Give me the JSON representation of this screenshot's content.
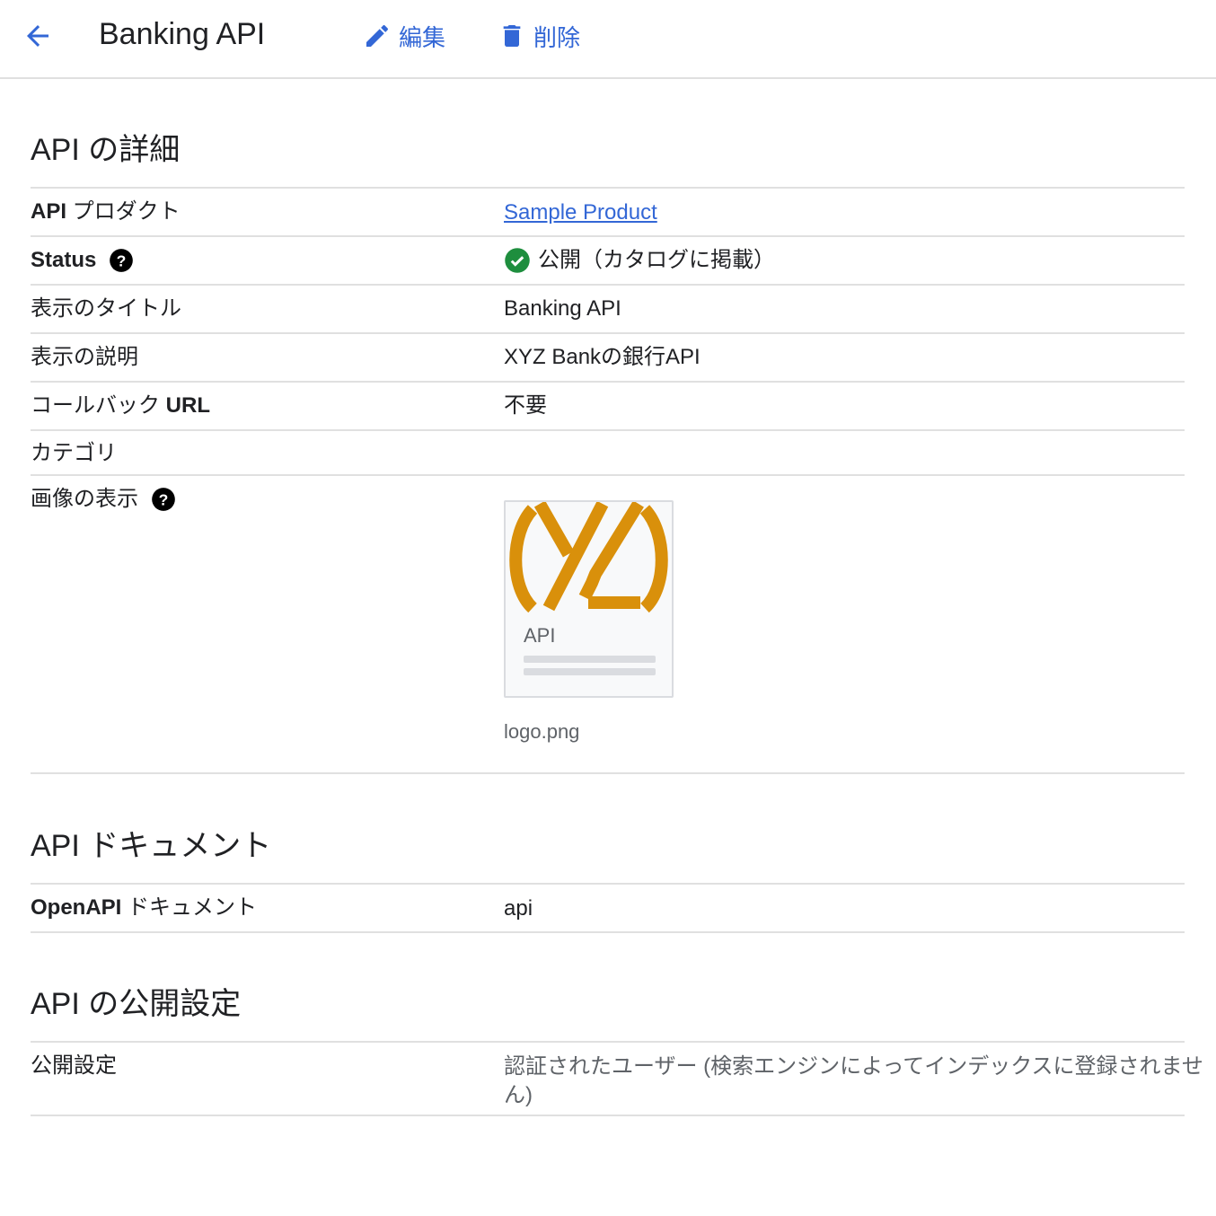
{
  "header": {
    "title": "Banking API",
    "edit_label": "編集",
    "delete_label": "削除"
  },
  "details": {
    "heading": "API の詳細",
    "rows": {
      "product": {
        "label_bold": "API",
        "label_rest": " プロダクト",
        "value": "Sample Product"
      },
      "status": {
        "label": "Status",
        "value": "公開（カタログに掲載）"
      },
      "display_title": {
        "label": "表示のタイトル",
        "value": "Banking API"
      },
      "description": {
        "label": "表示の説明",
        "value": "XYZ Bankの銀行API"
      },
      "callback": {
        "label_rest": "コールバック ",
        "label_bold": "URL",
        "value": "不要"
      },
      "category": {
        "label": "カテゴリ",
        "value": ""
      },
      "image": {
        "label": "画像の表示",
        "card_text": "API",
        "filename": "logo.png"
      }
    }
  },
  "docs": {
    "heading": "API ドキュメント",
    "row": {
      "label_bold": "OpenAPI",
      "label_rest": " ドキュメント",
      "value": "api"
    }
  },
  "visibility": {
    "heading": "API の公開設定",
    "row": {
      "label": "公開設定",
      "value_line1": "認証されたユーザー (検索エンジンによってインデックスに登録されませ",
      "value_line2": "ん)"
    }
  },
  "colors": {
    "accent": "#3367d6",
    "success": "#1e8e3e",
    "logo_orange": "#d9900b"
  },
  "icons": [
    "arrow-back-icon",
    "pencil-icon",
    "trash-icon",
    "help-icon",
    "check-circle-icon"
  ]
}
